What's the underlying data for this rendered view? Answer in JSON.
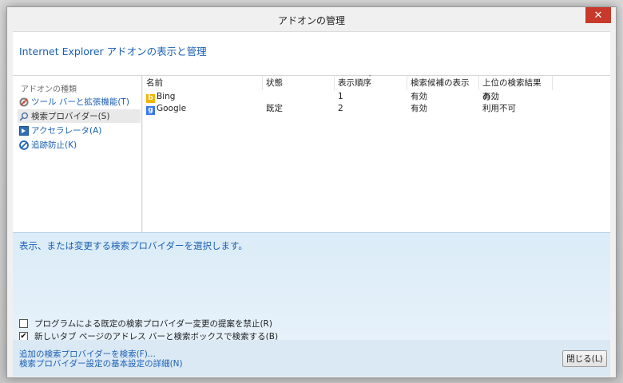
{
  "window": {
    "title": "アドオンの管理",
    "close_glyph": "✕"
  },
  "header": {
    "title": "Internet Explorer アドオンの表示と管理"
  },
  "sidebar": {
    "label": "アドオンの種類",
    "items": [
      {
        "label": "ツール バーと拡張機能(T)",
        "icon": "toolbar-extensions-icon",
        "selected": false
      },
      {
        "label": "検索プロバイダー(S)",
        "icon": "search-icon",
        "selected": true
      },
      {
        "label": "アクセラレータ(A)",
        "icon": "accelerator-icon",
        "selected": false
      },
      {
        "label": "追跡防止(K)",
        "icon": "tracking-protection-icon",
        "selected": false
      }
    ]
  },
  "table": {
    "columns": [
      "名前",
      "状態",
      "表示順序",
      "検索候補の表示",
      "上位の検索結果の..."
    ],
    "sort_arrow": "ˆ",
    "rows": [
      {
        "name": "Bing",
        "status": "",
        "order": "1",
        "suggestions": "有効",
        "top_result": "有効",
        "icon_glyph": "b",
        "icon_color": "#f4b400"
      },
      {
        "name": "Google",
        "status": "既定",
        "order": "2",
        "suggestions": "有効",
        "top_result": "利用不可",
        "icon_glyph": "g",
        "icon_color": "#3b78e7"
      }
    ]
  },
  "details": {
    "message": "表示、または変更する検索プロバイダーを選択します。",
    "checkboxes": [
      {
        "label": "プログラムによる既定の検索プロバイダー変更の提案を禁止(R)",
        "checked": false
      },
      {
        "label": "新しいタブ ページのアドレス バーと検索ボックスで検索する(B)",
        "checked": true
      }
    ],
    "check_glyph": "✔"
  },
  "footer": {
    "links": [
      "追加の検索プロバイダーを検索(F)...",
      "検索プロバイダー設定の基本設定の詳細(N)"
    ],
    "close_button": "閉じる(L)"
  }
}
